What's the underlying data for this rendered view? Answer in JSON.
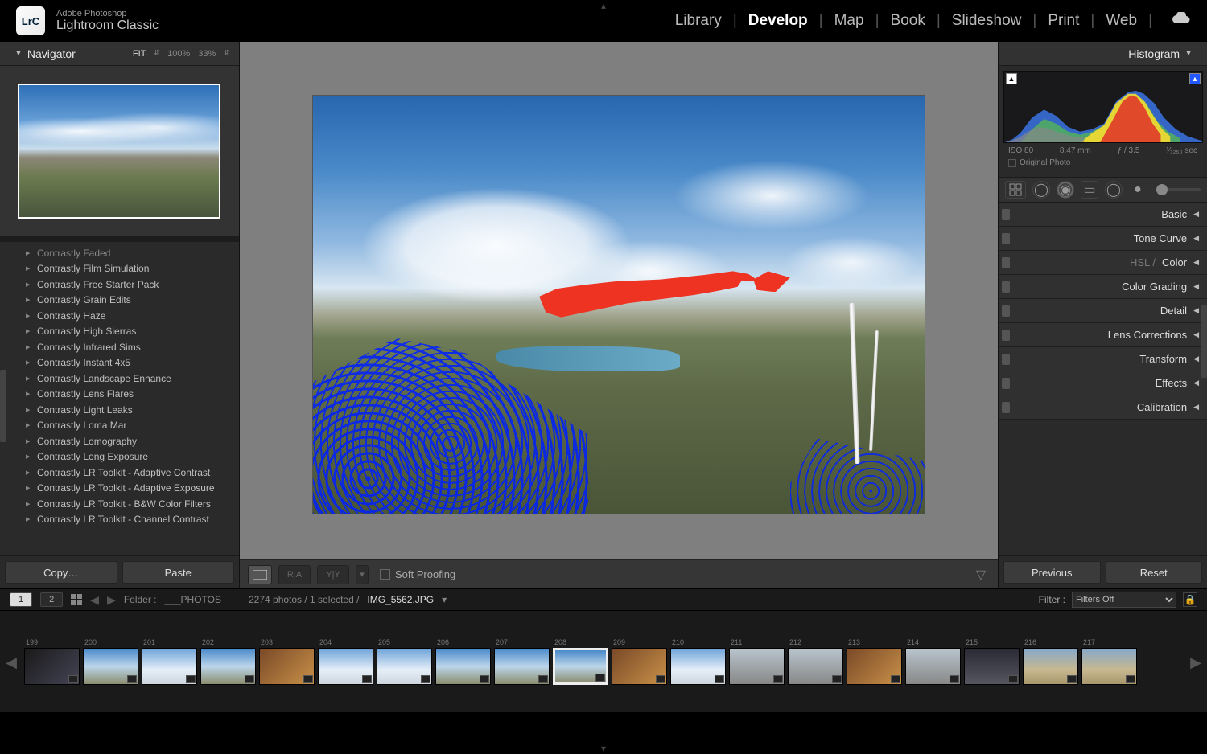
{
  "app": {
    "vendor": "Adobe Photoshop",
    "name": "Lightroom Classic",
    "logo_text": "LrC"
  },
  "modules": [
    "Library",
    "Develop",
    "Map",
    "Book",
    "Slideshow",
    "Print",
    "Web"
  ],
  "active_module": "Develop",
  "navigator": {
    "title": "Navigator",
    "zoom": {
      "fit": "FIT",
      "z100": "100%",
      "z33": "33%"
    }
  },
  "presets": [
    "Contrastly Faded",
    "Contrastly Film Simulation",
    "Contrastly Free Starter Pack",
    "Contrastly Grain Edits",
    "Contrastly Haze",
    "Contrastly High Sierras",
    "Contrastly Infrared Sims",
    "Contrastly Instant 4x5",
    "Contrastly Landscape Enhance",
    "Contrastly Lens Flares",
    "Contrastly Light Leaks",
    "Contrastly Loma Mar",
    "Contrastly Lomography",
    "Contrastly Long Exposure",
    "Contrastly LR Toolkit - Adaptive Contrast",
    "Contrastly LR Toolkit - Adaptive Exposure",
    "Contrastly LR Toolkit - B&W Color Filters",
    "Contrastly LR Toolkit - Channel Contrast"
  ],
  "left_buttons": {
    "copy": "Copy…",
    "paste": "Paste"
  },
  "soft_proofing": "Soft Proofing",
  "histogram": {
    "title": "Histogram",
    "iso": "ISO 80",
    "focal": "8.47 mm",
    "aperture": "ƒ / 3.5",
    "shutter": "¹⁄₁₂₅₀ sec",
    "original": "Original Photo"
  },
  "right_panels": [
    {
      "label": "Basic"
    },
    {
      "label": "Tone Curve"
    },
    {
      "label_dim": "HSL / ",
      "label": "Color"
    },
    {
      "label": "Color Grading"
    },
    {
      "label": "Detail"
    },
    {
      "label": "Lens Corrections"
    },
    {
      "label": "Transform"
    },
    {
      "label": "Effects"
    },
    {
      "label": "Calibration"
    }
  ],
  "right_buttons": {
    "previous": "Previous",
    "reset": "Reset"
  },
  "filmstrip_bar": {
    "tab1": "1",
    "tab2": "2",
    "folder_label": "Folder :",
    "folder_name": "___PHOTOS",
    "count": "2274 photos / 1 selected /",
    "filename": "IMG_5562.JPG",
    "filter_label": "Filter :",
    "filter_value": "Filters Off"
  },
  "thumbs": [
    {
      "n": "199",
      "cls": "portrait"
    },
    {
      "n": "200",
      "cls": "sky"
    },
    {
      "n": "201",
      "cls": "snow"
    },
    {
      "n": "202",
      "cls": "sky"
    },
    {
      "n": "203",
      "cls": "warm"
    },
    {
      "n": "204",
      "cls": "snow"
    },
    {
      "n": "205",
      "cls": "snow"
    },
    {
      "n": "206",
      "cls": "sky"
    },
    {
      "n": "207",
      "cls": "sky"
    },
    {
      "n": "208",
      "cls": "sky",
      "selected": true
    },
    {
      "n": "209",
      "cls": "warm"
    },
    {
      "n": "210",
      "cls": "snow"
    },
    {
      "n": "211",
      "cls": "city"
    },
    {
      "n": "212",
      "cls": "city"
    },
    {
      "n": "213",
      "cls": "warm"
    },
    {
      "n": "214",
      "cls": "city"
    },
    {
      "n": "215",
      "cls": "dark"
    },
    {
      "n": "216",
      "cls": "pano"
    },
    {
      "n": "217",
      "cls": "pano"
    }
  ]
}
